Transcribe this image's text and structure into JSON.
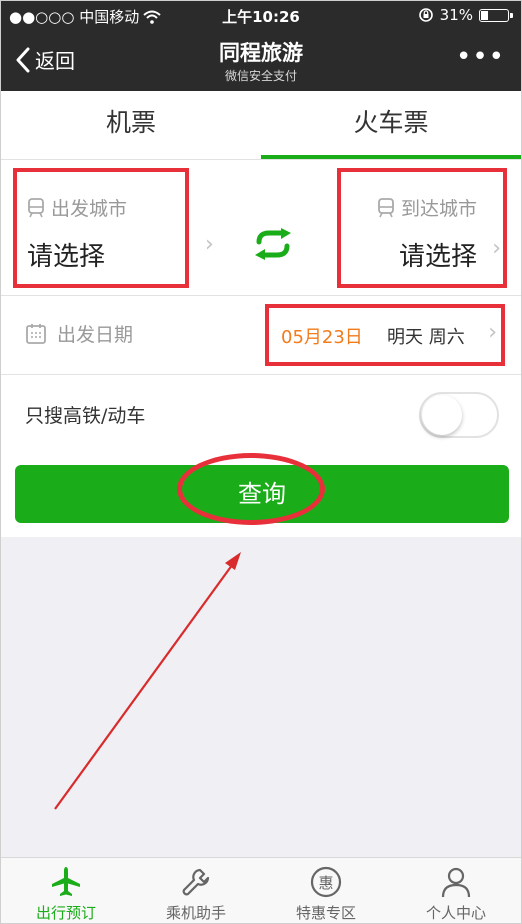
{
  "status_bar": {
    "carrier": "●●○○○ 中国移动",
    "time": "上午10:26",
    "battery_percent": "31%",
    "battery_level": 0.31
  },
  "nav": {
    "back_label": "返回",
    "title": "同程旅游",
    "subtitle": "微信安全支付",
    "more_label": "•••"
  },
  "tabs": [
    {
      "label": "机票",
      "active": false
    },
    {
      "label": "火车票",
      "active": true
    }
  ],
  "form": {
    "from_label": "出发城市",
    "from_value": "请选择",
    "to_label": "到达城市",
    "to_value": "请选择",
    "date_label": "出发日期",
    "date_value": "05月23日",
    "date_desc": "明天 周六",
    "highspeed_label": "只搜高铁/动车",
    "highspeed_on": false,
    "search_label": "查询"
  },
  "tabbar": [
    {
      "label": "出行预订",
      "icon": "plane-icon",
      "active": true
    },
    {
      "label": "乘机助手",
      "icon": "wrench-icon",
      "active": false
    },
    {
      "label": "特惠专区",
      "icon": "discount-icon",
      "active": false
    },
    {
      "label": "个人中心",
      "icon": "person-icon",
      "active": false
    }
  ],
  "colors": {
    "accent": "#1aad19",
    "highlight": "#e8303a",
    "date": "#f27b1b",
    "navbar": "#2b2b2b"
  }
}
